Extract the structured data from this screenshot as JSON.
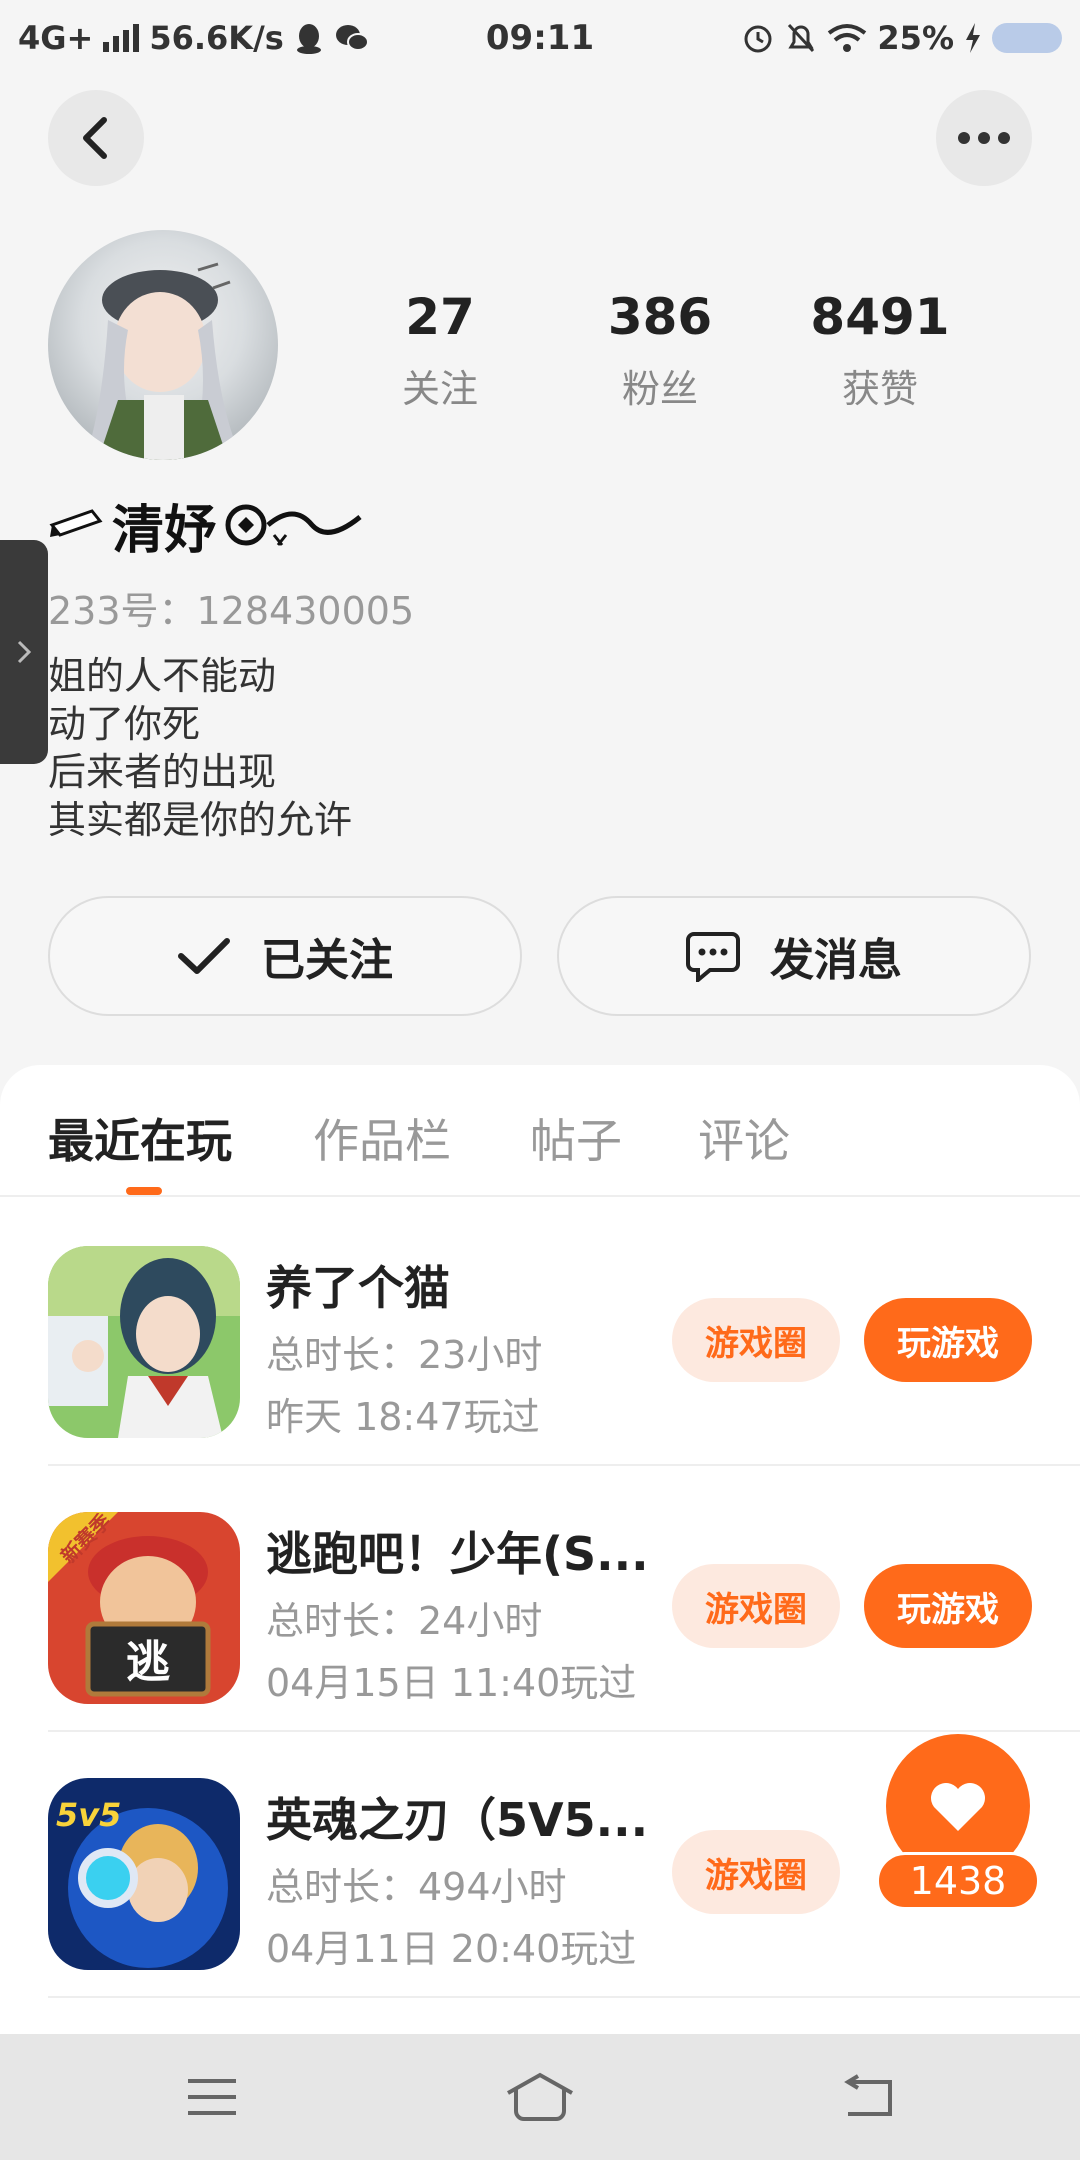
{
  "status_bar": {
    "network": "4G+",
    "speed": "56.6K/s",
    "time": "09:11",
    "battery": "25%"
  },
  "profile": {
    "username": "清妤",
    "uid": "233号：128430005",
    "bio": [
      "姐的人不能动",
      "动了你死",
      "后来者的出现",
      "其实都是你的允许"
    ],
    "stats": [
      {
        "value": "27",
        "label": "关注"
      },
      {
        "value": "386",
        "label": "粉丝"
      },
      {
        "value": "8491",
        "label": "获赞"
      }
    ]
  },
  "actions": {
    "follow_label": "已关注",
    "message_label": "发消息"
  },
  "tabs": [
    "最近在玩",
    "作品栏",
    "帖子",
    "评论"
  ],
  "games": [
    {
      "title": "养了个猫",
      "duration": "总时长：23小时",
      "last_played": "昨天 18:47玩过",
      "circle_label": "游戏圈",
      "play_label": "玩游戏"
    },
    {
      "title": "逃跑吧！少年(S...",
      "duration": "总时长：24小时",
      "last_played": "04月15日 11:40玩过",
      "circle_label": "游戏圈",
      "play_label": "玩游戏"
    },
    {
      "title": "英魂之刃（5V5...",
      "duration": "总时长：494小时",
      "last_played": "04月11日 20:40玩过",
      "circle_label": "游戏圈",
      "play_label": ""
    }
  ],
  "game_icon_texts": {
    "game2_badge": "新赛季",
    "game2_sign": "逃",
    "game3_badge": "5v5"
  },
  "like_float": {
    "count": "1438"
  },
  "colors": {
    "accent": "#ff6a1a",
    "accent_light": "#fde9df",
    "background": "#f5f5f5"
  }
}
